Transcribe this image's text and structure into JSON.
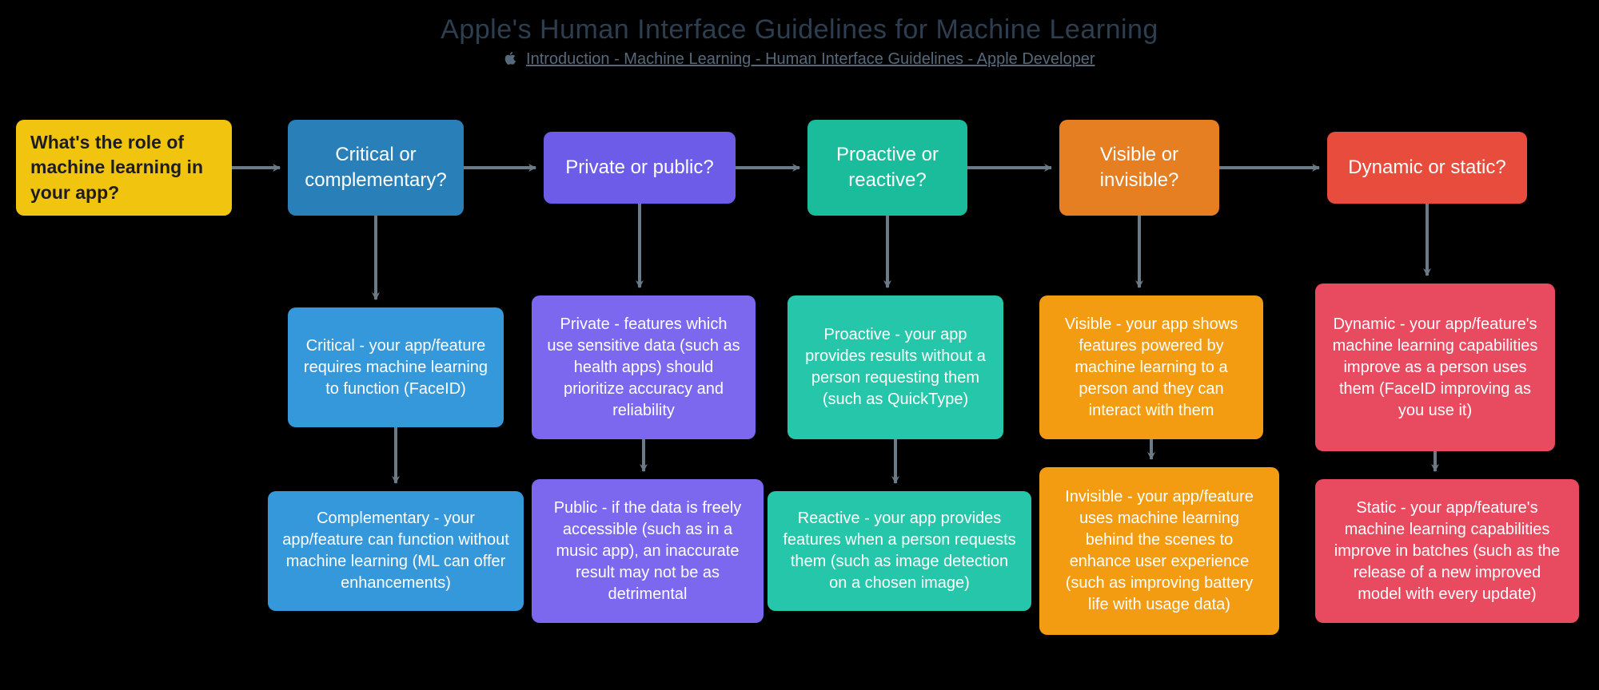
{
  "header": {
    "title": "Apple's Human Interface Guidelines for Machine Learning",
    "subtitle_text": "Introduction - Machine Learning - Human Interface Guidelines - Apple Developer"
  },
  "diagram": {
    "start": "What's the role of machine learning in your app?",
    "columns": [
      {
        "question": "Critical or complementary?",
        "answer1": "Critical - your app/feature requires machine learning to function (FaceID)",
        "answer2": "Complementary - your app/feature can function without machine learning (ML can offer enhancements)"
      },
      {
        "question": "Private or public?",
        "answer1": "Private - features which use sensitive data (such as health apps) should prioritize accuracy and reliability",
        "answer2": "Public - if the data is freely accessible (such as in a music app), an inaccurate result may not be as detrimental"
      },
      {
        "question": "Proactive or reactive?",
        "answer1": "Proactive - your app provides results without a person requesting them (such as QuickType)",
        "answer2": "Reactive - your app provides features when a person requests them (such as image detection on a chosen image)"
      },
      {
        "question": "Visible or invisible?",
        "answer1": "Visible - your app shows features powered by machine learning to a person and they can interact with them",
        "answer2": "Invisible - your app/feature uses machine learning behind the scenes to enhance user experience (such as improving battery life with usage data)"
      },
      {
        "question": "Dynamic or static?",
        "answer1": "Dynamic - your app/feature's machine learning capabilities improve as a person uses them (FaceID improving as you use it)",
        "answer2": "Static - your app/feature's machine learning capabilities improve in batches (such as the release of a new improved model with every update)"
      }
    ]
  }
}
